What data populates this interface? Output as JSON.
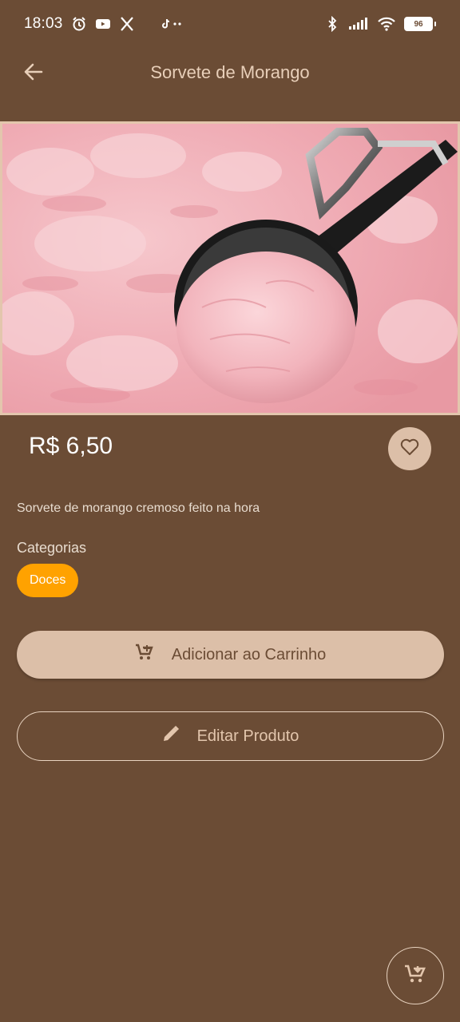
{
  "status_bar": {
    "time": "18:03",
    "battery": "96"
  },
  "app_bar": {
    "title": "Sorvete de Morango"
  },
  "product": {
    "price": "R$ 6,50",
    "description": "Sorvete de morango cremoso feito na hora",
    "categories_label": "Categorias",
    "categories": [
      "Doces"
    ]
  },
  "actions": {
    "add_to_cart": "Adicionar ao Carrinho",
    "edit_product": "Editar Produto"
  },
  "icons": {
    "back": "arrow-left-icon",
    "favorite": "heart-outline-icon",
    "add_cart": "cart-plus-icon",
    "edit": "pencil-icon",
    "fab": "cart-download-icon"
  },
  "colors": {
    "background": "#6b4c35",
    "accent": "#dcbfa8",
    "chip": "#ffa200",
    "title": "#e8cfb9"
  }
}
